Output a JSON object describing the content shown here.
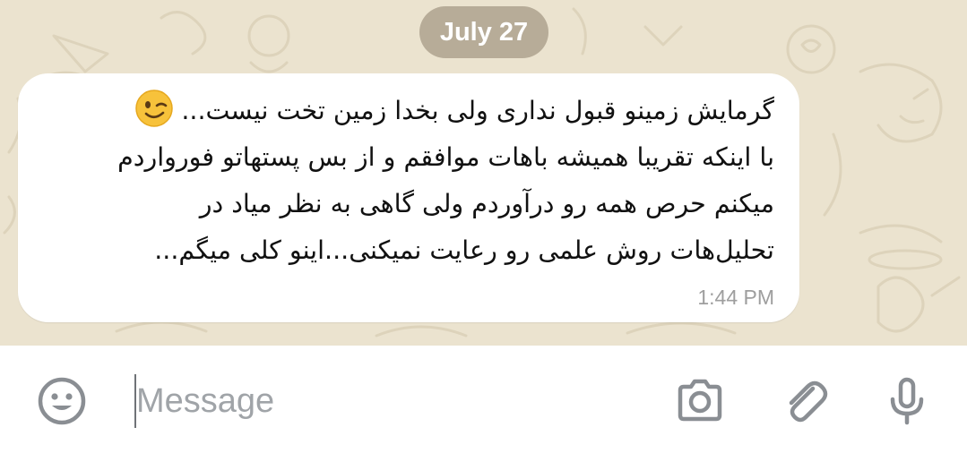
{
  "chat": {
    "date_label": "July 27",
    "message": {
      "lines": [
        "گرمایش زمینو قبول نداری ولی بخدا زمین تخت نیست...",
        "با اینکه تقریبا همیشه باهات موافقم و از بس پستهاتو فورواردم",
        "میکنم حرص همه رو درآوردم ولی گاهی به نظر میاد در",
        "تحلیل‌هات روش علمی رو رعایت نمیکنی...اینو کلی میگم..."
      ],
      "emoji": "winking-face",
      "time": "1:44 PM"
    }
  },
  "composer": {
    "placeholder": "Message",
    "value": "",
    "icons": {
      "emoji": "smiley-face-icon",
      "camera": "camera-icon",
      "attach": "paperclip-icon",
      "mic": "microphone-icon"
    }
  },
  "colors": {
    "wallpaper": "#ebe3cf",
    "bubble": "#ffffff",
    "date_chip": "#a99f8c",
    "icon": "#8a8e93",
    "time": "#9e9e9e"
  }
}
